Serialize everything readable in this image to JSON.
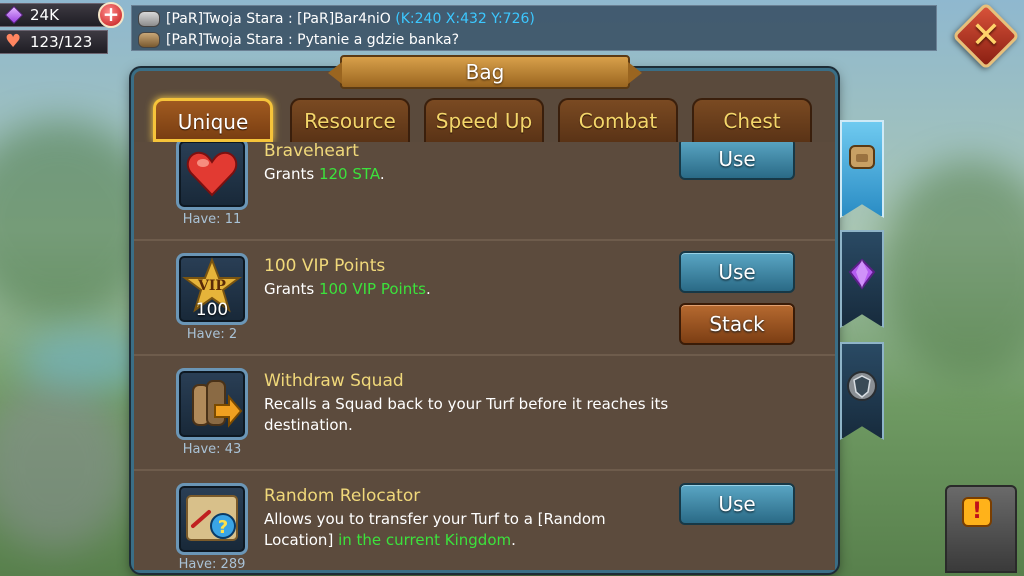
{
  "resources": {
    "gems": "24K",
    "health": "123/123"
  },
  "chat": {
    "line1_sender": "[PaR]Twoja Stara :",
    "line1_text": "[PaR]Bar4niO",
    "line1_coords": "(K:240 X:432 Y:726)",
    "line2_sender": "[PaR]Twoja Stara :",
    "line2_text": "Pytanie a gdzie banka?"
  },
  "bag": {
    "title": "Bag",
    "tabs": [
      "Unique",
      "Resource",
      "Speed Up",
      "Combat",
      "Chest"
    ],
    "active_tab": "Unique",
    "items": [
      {
        "name": "Braveheart",
        "desc_prefix": "Grants ",
        "desc_highlight": "120 STA",
        "desc_suffix": ".",
        "have": "Have: 11",
        "use_label": "Use"
      },
      {
        "name": "100 VIP Points",
        "desc_prefix": "Grants ",
        "desc_highlight": "100 VIP Points",
        "desc_suffix": ".",
        "have": "Have: 2",
        "badge": "100",
        "badge_top": "VIP",
        "use_label": "Use",
        "stack_label": "Stack"
      },
      {
        "name": "Withdraw Squad",
        "desc_prefix": "Recalls a Squad back to your Turf before it reaches its destination.",
        "have": "Have: 43"
      },
      {
        "name": "Random Relocator",
        "desc_prefix": "Allows you to transfer your Turf to a [Random Location] ",
        "desc_highlight": "in the current Kingdom",
        "desc_suffix": ".",
        "have": "Have: 289",
        "use_label": "Use"
      }
    ]
  },
  "icons": {
    "close": "close-icon",
    "gem": "gem-icon",
    "heart": "heart-icon",
    "add": "plus-icon"
  },
  "colors": {
    "highlight": "#3ce23c",
    "item_name": "#f0d87a",
    "coords": "#3cc8ff",
    "use_button": "#2a6a86",
    "stack_button": "#7c3e14",
    "active_tab_border": "#f6c43a"
  }
}
